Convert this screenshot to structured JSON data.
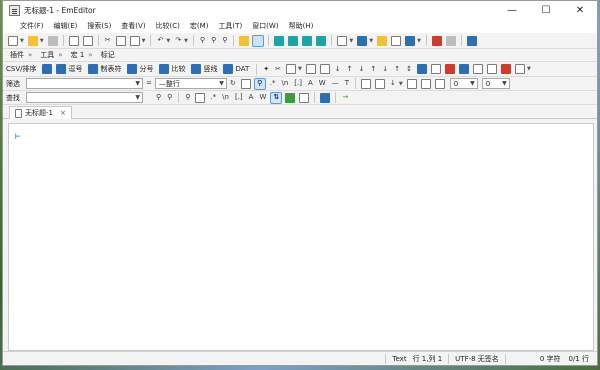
{
  "window": {
    "title": "无标题-1 - EmEditor"
  },
  "menu": [
    "文件(F)",
    "编辑(E)",
    "搜索(S)",
    "查看(V)",
    "比较(C)",
    "宏(M)",
    "工具(T)",
    "窗口(W)",
    "帮助(H)"
  ],
  "toolbar2": {
    "plugins_label": "插件",
    "tools_label": "工具",
    "macro_label": "宏",
    "macro_value": "1",
    "markers_label": "标记"
  },
  "modes": {
    "csv_label": "CSV/排序",
    "comma_label": "逗号",
    "tab_label": "制表符",
    "semicolon_label": "分号",
    "compare_label": "比较",
    "vertical_label": "竖线",
    "dat_label": "DAT"
  },
  "filter": {
    "label": "筛选",
    "value": "",
    "scope_value": "—整行"
  },
  "find": {
    "label": "查找",
    "value": ""
  },
  "tabs": {
    "doc_title": "无标题-1",
    "close_glyph": "×"
  },
  "editor": {
    "cursor_glyph": "⊢"
  },
  "status": {
    "mode": "Text",
    "position": "行 1,列 1",
    "encoding": "UTF-8 无签名",
    "chars": "0 字符",
    "lines": "0/1 行"
  },
  "toolbar_glyphs": {
    "regex": ".*",
    "newline": "\\n",
    "bracket": "[.]",
    "word": "W",
    "find_next": "→",
    "page_count": "0",
    "font_size_a": "A"
  },
  "colors": {
    "accent_blue": "#2b6fb6",
    "teal": "#1aa6a6",
    "stop_red": "#d23a2a",
    "cursor_blue": "#3a78c6"
  }
}
